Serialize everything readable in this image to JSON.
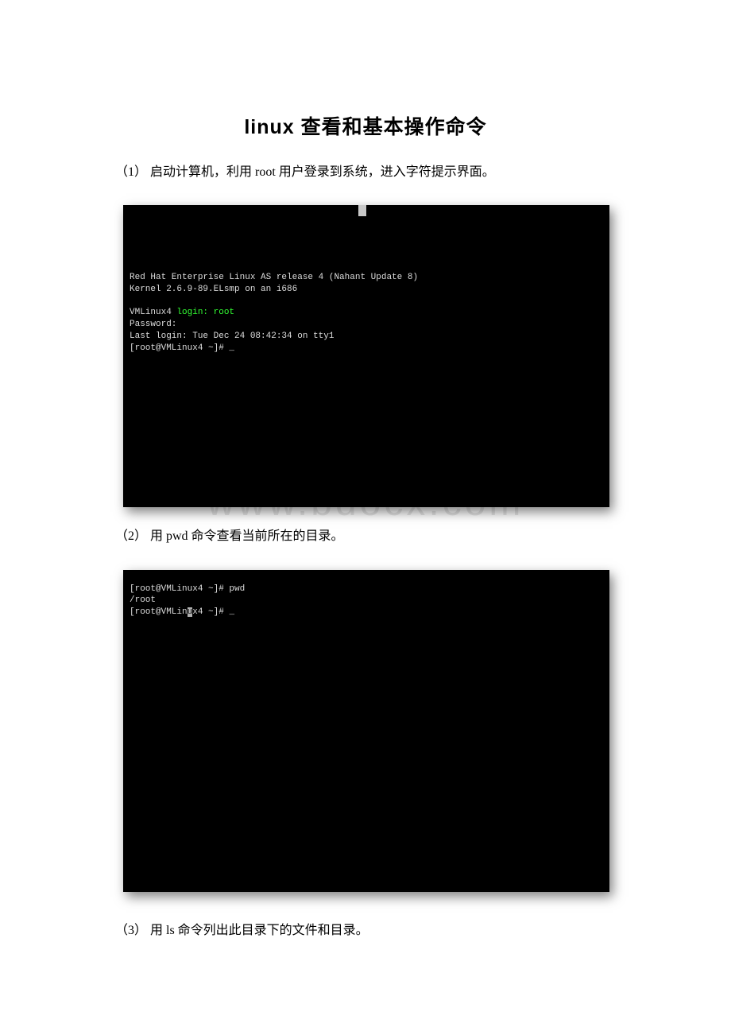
{
  "title": "linux 查看和基本操作命令",
  "watermark": "www.bdocx.com",
  "steps": {
    "s1": "（1） 启动计算机，利用 root 用户登录到系统，进入字符提示界面。",
    "s2": "（2） 用 pwd 命令查看当前所在的目录。",
    "s3": "（3） 用 ls 命令列出此目录下的文件和目录。"
  },
  "term1": {
    "l1": "Red Hat Enterprise Linux AS release 4 (Nahant Update 8)",
    "l2": "Kernel 2.6.9-89.ELsmp on an i686",
    "l3a": "VMLinux4 ",
    "l3b": "login:",
    "l3c": " root",
    "l4": "Password:",
    "l5": "Last login: Tue Dec 24 08:42:34 on tty1",
    "l6": "[root@VMLinux4 ~]# "
  },
  "term2": {
    "l1": "[root@VMLinux4 ~]# pwd",
    "l2": "/root",
    "l3a": "[root@VMLin",
    "l3b": "u",
    "l3c": "x4 ~]# "
  }
}
